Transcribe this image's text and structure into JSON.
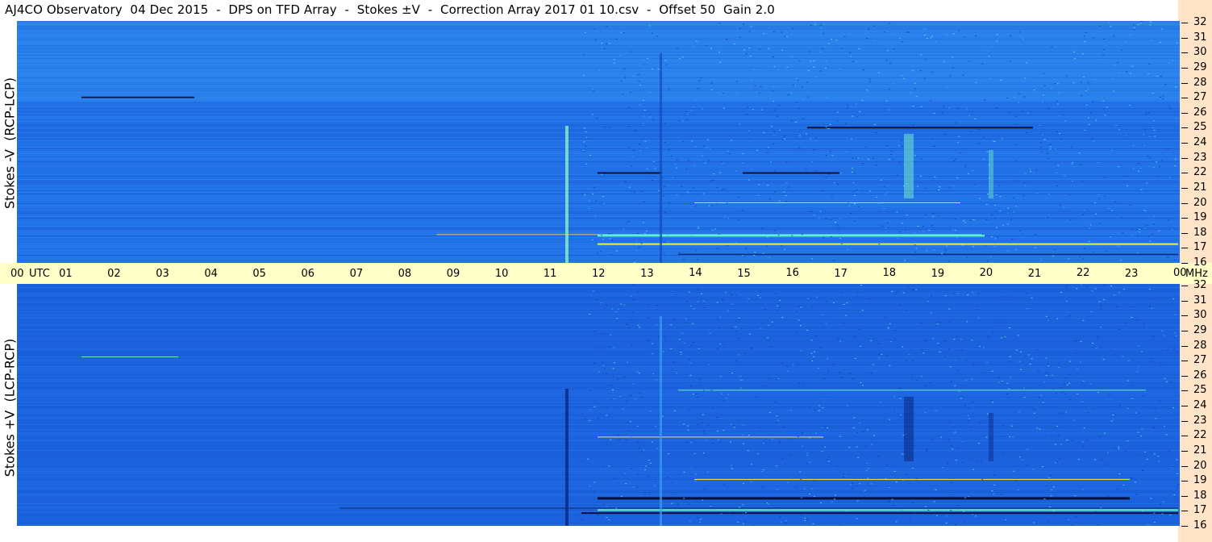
{
  "title": "AJ4CO Observatory  04 Dec 2015  -  DPS on TFD Array  -  Stokes ±V  -  Correction Array 2017 01 10.csv  -  Offset 50  Gain 2.0",
  "colors": {
    "panel": "#ffe4c8",
    "time_bar": "#ffffc8",
    "spectrogram_base": "#1e63e0",
    "emission_yellow": "#f0f040",
    "emission_cyan": "#60f0d0"
  },
  "chart_data": [
    {
      "type": "heatmap",
      "title": "AJ4CO Observatory  04 Dec 2015  -  DPS on TFD Array  -  Stokes ±V  -  Correction Array 2017 01 10.csv  -  Offset 50  Gain 2.0",
      "ylabel": "Stokes -V  (RCP-LCP)",
      "xlabel": "UTC",
      "y_unit": "MHz",
      "ylim": [
        16,
        32
      ],
      "xlim": [
        0,
        24
      ],
      "x_ticks": [
        "00",
        "01",
        "02",
        "03",
        "04",
        "05",
        "06",
        "07",
        "08",
        "09",
        "10",
        "11",
        "12",
        "13",
        "14",
        "15",
        "16",
        "17",
        "18",
        "19",
        "20",
        "21",
        "22",
        "23",
        "00"
      ],
      "y_ticks": [
        "16",
        "17",
        "18",
        "19",
        "20",
        "21",
        "22",
        "23",
        "24",
        "25",
        "26",
        "27",
        "28",
        "29",
        "30",
        "31",
        "32"
      ]
    },
    {
      "type": "heatmap",
      "ylabel": "Stokes +V  (LCP-RCP)",
      "xlabel": "UTC",
      "y_unit": "MHz",
      "ylim": [
        16,
        32
      ],
      "xlim": [
        0,
        24
      ],
      "x_ticks": [
        "00",
        "01",
        "02",
        "03",
        "04",
        "05",
        "06",
        "07",
        "08",
        "09",
        "10",
        "11",
        "12",
        "13",
        "14",
        "15",
        "16",
        "17",
        "18",
        "19",
        "20",
        "21",
        "22",
        "23",
        "00"
      ],
      "y_ticks": [
        "16",
        "17",
        "18",
        "19",
        "20",
        "21",
        "22",
        "23",
        "24",
        "25",
        "26",
        "27",
        "28",
        "29",
        "30",
        "31",
        "32"
      ]
    }
  ]
}
